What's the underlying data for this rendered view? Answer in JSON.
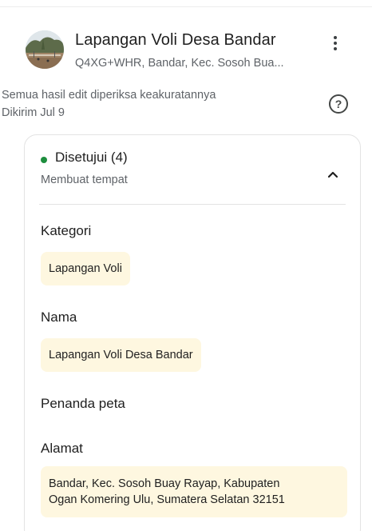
{
  "place": {
    "title": "Lapangan Voli Desa Bandar",
    "address": "Q4XG+WHR, Bandar, Kec. Sosoh Bua..."
  },
  "edit_meta": {
    "verification_note": "Semua hasil edit diperiksa keakuratannya",
    "submitted": "Dikirim Jul 9",
    "help_glyph": "?"
  },
  "card": {
    "status_label": "Disetujui (4)",
    "status_color": "#1e8e3e",
    "status_sub": "Membuat tempat",
    "sections": {
      "kategori": {
        "label": "Kategori",
        "value": "Lapangan Voli"
      },
      "nama": {
        "label": "Nama",
        "value": "Lapangan Voli Desa Bandar"
      },
      "penanda": {
        "label": "Penanda peta"
      },
      "alamat": {
        "label": "Alamat",
        "value_line1": "Bandar, Kec. Sosoh Buay Rayap, Kabupaten",
        "value_line2": "Ogan Komering Ulu, Sumatera Selatan 32151"
      }
    }
  },
  "icons": {
    "more": "more-vert-icon",
    "help": "help-circle-icon",
    "collapse": "chevron-up-icon"
  }
}
